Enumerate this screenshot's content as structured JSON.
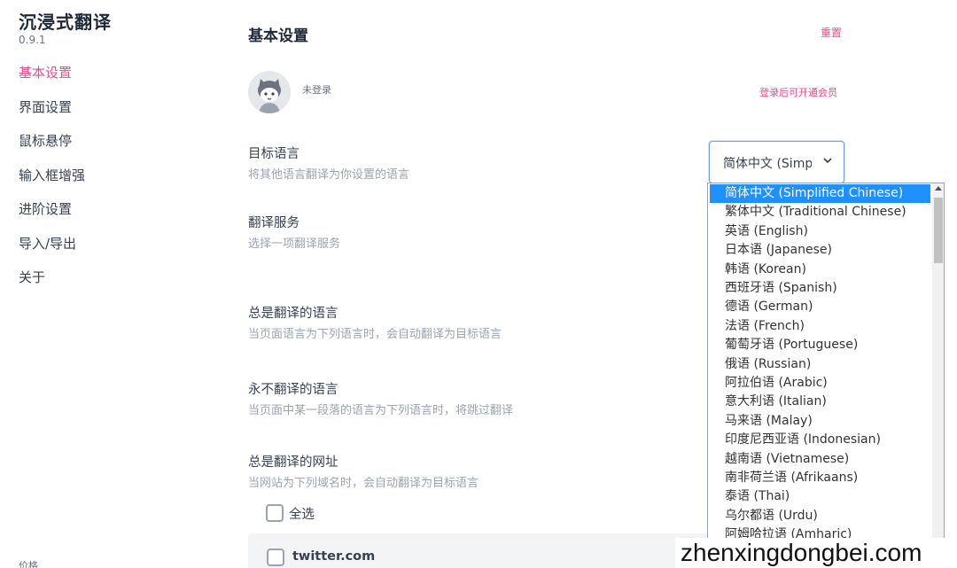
{
  "app": {
    "title": "沉浸式翻译",
    "version": "0.9.1"
  },
  "sidebar": {
    "items": [
      {
        "label": "基本设置",
        "active": true
      },
      {
        "label": "界面设置"
      },
      {
        "label": "鼠标悬停"
      },
      {
        "label": "输入框增强"
      },
      {
        "label": "进阶设置"
      },
      {
        "label": "导入/导出"
      },
      {
        "label": "关于"
      }
    ],
    "price_label": "价格"
  },
  "main": {
    "title": "基本设置",
    "reset_label": "重置",
    "account": {
      "status": "未登录",
      "member_link": "登录后可开通会员"
    },
    "settings": [
      {
        "title": "目标语言",
        "desc": "将其他语言翻译为你设置的语言"
      },
      {
        "title": "翻译服务",
        "desc": "选择一项翻译服务"
      },
      {
        "title": "总是翻译的语言",
        "desc": "当页面语言为下列语言时，会自动翻译为目标语言"
      },
      {
        "title": "永不翻译的语言",
        "desc": "当页面中某一段落的语言为下列语言时，将跳过翻译"
      },
      {
        "title": "总是翻译的网址",
        "desc": "当网站为下列域名时，会自动翻译为目标语言"
      }
    ],
    "select_all_label": "全选",
    "sites": [
      "twitter.com"
    ]
  },
  "language_select": {
    "value": "简体中文 (Simplified Chinese)",
    "options": [
      "简体中文 (Simplified Chinese)",
      "繁体中文 (Traditional Chinese)",
      "英语 (English)",
      "日本语 (Japanese)",
      "韩语 (Korean)",
      "西班牙语 (Spanish)",
      "德语 (German)",
      "法语 (French)",
      "葡萄牙语 (Portuguese)",
      "俄语 (Russian)",
      "阿拉伯语 (Arabic)",
      "意大利语 (Italian)",
      "马来语 (Malay)",
      "印度尼西亚语 (Indonesian)",
      "越南语 (Vietnamese)",
      "南非荷兰语 (Afrikaans)",
      "泰语 (Thai)",
      "乌尔都语 (Urdu)",
      "阿姆哈拉语 (Amharic)"
    ]
  },
  "watermark": "zhenxingdongbei.com",
  "colors": {
    "accent": "#ea4c89",
    "selected_option": "#1e90ff",
    "muted_text": "#9ca3af"
  },
  "icons": {
    "avatar": "cartoon-cat-avatar",
    "select_arrow": "chevron-down-icon"
  }
}
